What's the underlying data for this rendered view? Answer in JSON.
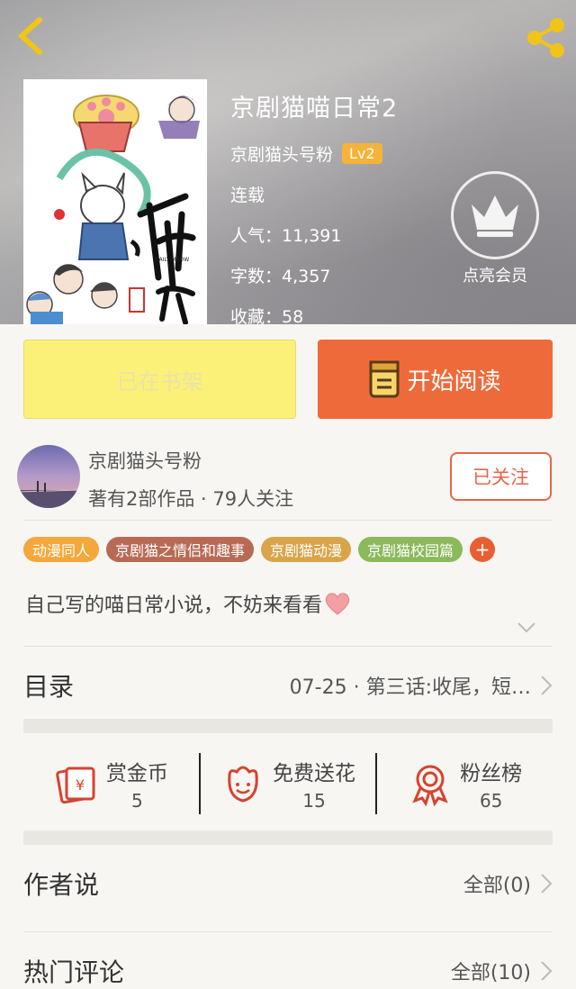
{
  "header": {
    "book_title": "京剧猫喵日常2",
    "author_name": "京剧猫头号粉",
    "author_level": "Lv2",
    "status": "连载",
    "popularity": "人气：11,391",
    "word_count": "字数：4,357",
    "favorites": "收藏：58",
    "vip_label": "点亮会员"
  },
  "actions": {
    "shelf_label": "已在书架",
    "read_label": "开始阅读"
  },
  "author_card": {
    "name": "京剧猫头号粉",
    "meta": "著有2部作品 · 79人关注",
    "follow_label": "已关注"
  },
  "tags": [
    {
      "label": "动漫同人",
      "color": "#f4a83b"
    },
    {
      "label": "京剧猫之情侣和趣事",
      "color": "#b86a55"
    },
    {
      "label": "京剧猫动漫",
      "color": "#d9a44a"
    },
    {
      "label": "京剧猫校园篇",
      "color": "#8bb95b"
    }
  ],
  "tag_add": "+",
  "description": "自己写的喵日常小说，不妨来看看",
  "catalog": {
    "title": "目录",
    "latest": "07-25 · 第三话:收尾，短…"
  },
  "stats": [
    {
      "label": "赏金币",
      "value": "5",
      "icon": "red-envelope-icon"
    },
    {
      "label": "免费送花",
      "value": "15",
      "icon": "flower-icon"
    },
    {
      "label": "粉丝榜",
      "value": "65",
      "icon": "medal-icon"
    }
  ],
  "author_says": {
    "title": "作者说",
    "link": "全部(0)"
  },
  "hot_comments": {
    "title": "热门评论",
    "link": "全部(10)"
  },
  "colors": {
    "accent": "#ef6a3a",
    "shelf": "#fbf178",
    "level_badge": "#f5b33a"
  }
}
